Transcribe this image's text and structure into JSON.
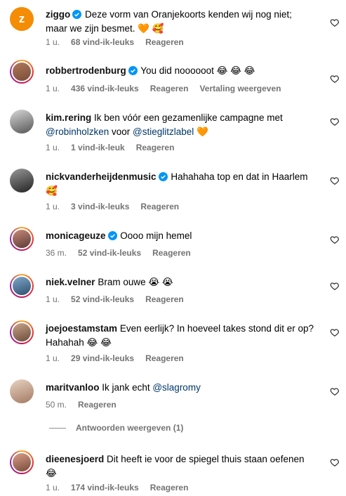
{
  "comments": [
    {
      "username": "ziggo",
      "verified": true,
      "text": "Deze vorm van Oranjekoorts kenden wij nog niet; maar we zijn besmet. 🧡 🥰",
      "time": "1 u.",
      "likes": "68 vind-ik-leuks",
      "reply": "Reageren"
    },
    {
      "username": "robbertrodenburg",
      "verified": true,
      "text": "You did noooooot 😂 😂 😂",
      "time": "1 u.",
      "likes": "436 vind-ik-leuks",
      "reply": "Reageren",
      "translate": "Vertaling weergeven"
    },
    {
      "username": "kim.rering",
      "verified": false,
      "text_before": "Ik ben vóór een gezamenlijke campagne met ",
      "mention1": "@robinholzken",
      "text_mid": " voor ",
      "mention2": "@stieglitzlabel",
      "text_after": " 🧡",
      "time": "1 u.",
      "likes": "1 vind-ik-leuk",
      "reply": "Reageren"
    },
    {
      "username": "nickvanderheijdenmusic",
      "verified": true,
      "text": "Hahahaha top en dat in Haarlem 🥰",
      "time": "1 u.",
      "likes": "3 vind-ik-leuks",
      "reply": "Reageren"
    },
    {
      "username": "monicageuze",
      "verified": true,
      "text": "Oooo mijn hemel",
      "time": "36 m.",
      "likes": "52 vind-ik-leuks",
      "reply": "Reageren"
    },
    {
      "username": "niek.velner",
      "verified": false,
      "text": "Bram ouwe 😭 😭",
      "time": "1 u.",
      "likes": "52 vind-ik-leuks",
      "reply": "Reageren"
    },
    {
      "username": "joejoestamstam",
      "verified": false,
      "text": "Even eerlijk? In hoeveel takes stond dit er op? Hahahah 😂 😂",
      "time": "1 u.",
      "likes": "29 vind-ik-leuks",
      "reply": "Reageren"
    },
    {
      "username": "maritvanloo",
      "verified": false,
      "text_before": "Ik jank echt ",
      "mention1": "@slagromy",
      "time": "50 m.",
      "reply": "Reageren"
    },
    {
      "username": "dieenesjoerd",
      "verified": false,
      "text": "Dit heeft ie voor de spiegel thuis staan oefenen 😂",
      "time": "1 u.",
      "likes": "174 vind-ik-leuks",
      "reply": "Reageren"
    }
  ],
  "view_replies": "Antwoorden weergeven (1)",
  "brand_initial": "z",
  "colors": {
    "verified": "#0095f6",
    "muted": "#737373",
    "mention": "#00376b",
    "brand": "#f48c06"
  }
}
